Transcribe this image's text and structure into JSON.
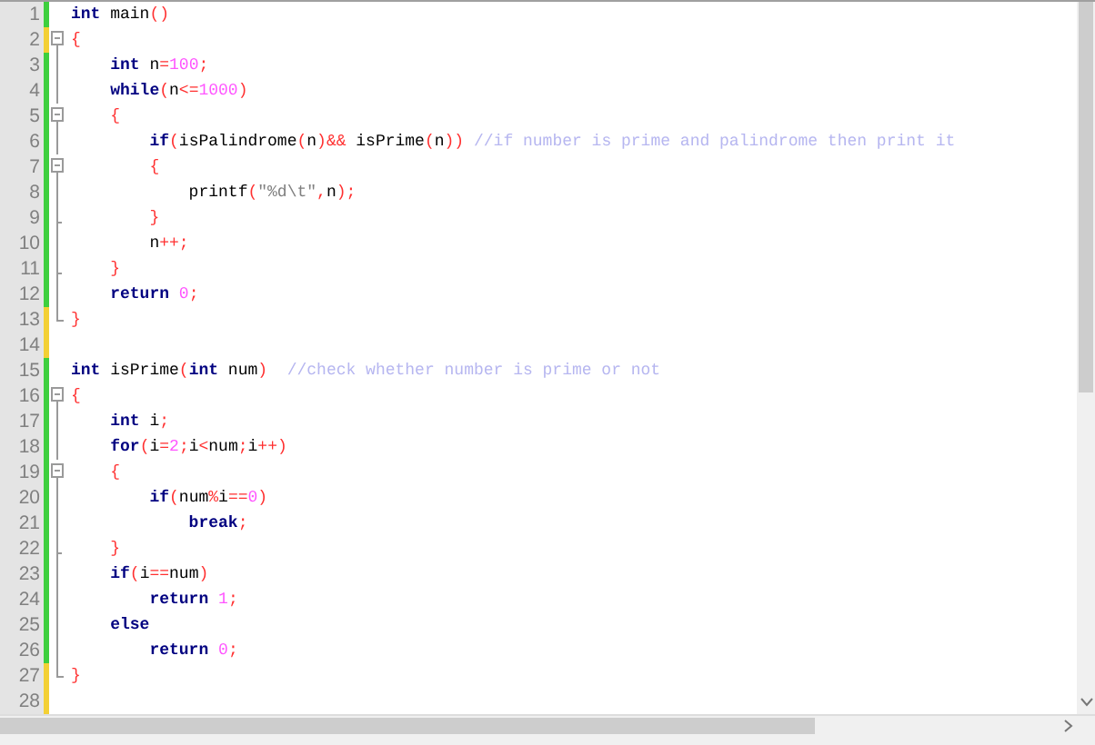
{
  "editor": {
    "lines": [
      {
        "number": "1",
        "saved": true,
        "kind": "plain",
        "tokens": [
          {
            "kind": "keyword",
            "text": "int"
          },
          {
            "kind": "plain",
            "text": " main"
          },
          {
            "kind": "op",
            "text": "()"
          }
        ]
      },
      {
        "number": "2",
        "saved": false,
        "kind": "start",
        "tokens": [
          {
            "kind": "op",
            "text": "{"
          }
        ]
      },
      {
        "number": "3",
        "saved": true,
        "kind": "body",
        "tokens": [
          {
            "kind": "keyword",
            "text": "    int"
          },
          {
            "kind": "plain",
            "text": " n"
          },
          {
            "kind": "op",
            "text": "="
          },
          {
            "kind": "number",
            "text": "100"
          },
          {
            "kind": "op",
            "text": ";"
          }
        ]
      },
      {
        "number": "4",
        "saved": true,
        "kind": "body",
        "tokens": [
          {
            "kind": "keyword",
            "text": "    while"
          },
          {
            "kind": "op",
            "text": "("
          },
          {
            "kind": "plain",
            "text": "n"
          },
          {
            "kind": "op",
            "text": "<="
          },
          {
            "kind": "number",
            "text": "1000"
          },
          {
            "kind": "op",
            "text": ")"
          }
        ]
      },
      {
        "number": "5",
        "saved": true,
        "kind": "start",
        "tokens": [
          {
            "kind": "op",
            "text": "    {"
          }
        ]
      },
      {
        "number": "6",
        "saved": true,
        "kind": "body",
        "tokens": [
          {
            "kind": "keyword",
            "text": "        if"
          },
          {
            "kind": "op",
            "text": "("
          },
          {
            "kind": "plain",
            "text": "isPalindrome"
          },
          {
            "kind": "op",
            "text": "("
          },
          {
            "kind": "plain",
            "text": "n"
          },
          {
            "kind": "op",
            "text": ")&&"
          },
          {
            "kind": "plain",
            "text": " isPrime"
          },
          {
            "kind": "op",
            "text": "("
          },
          {
            "kind": "plain",
            "text": "n"
          },
          {
            "kind": "op",
            "text": "))"
          },
          {
            "kind": "comment",
            "text": " //if number is prime and palindrome then print it"
          }
        ]
      },
      {
        "number": "7",
        "saved": true,
        "kind": "start",
        "tokens": [
          {
            "kind": "op",
            "text": "        {"
          }
        ]
      },
      {
        "number": "8",
        "saved": true,
        "kind": "body",
        "tokens": [
          {
            "kind": "plain",
            "text": "            printf"
          },
          {
            "kind": "op",
            "text": "("
          },
          {
            "kind": "string",
            "text": "\"%d\\t\""
          },
          {
            "kind": "op",
            "text": ","
          },
          {
            "kind": "plain",
            "text": "n"
          },
          {
            "kind": "op",
            "text": ");"
          }
        ]
      },
      {
        "number": "9",
        "saved": true,
        "kind": "stop",
        "tokens": [
          {
            "kind": "op",
            "text": "        }"
          }
        ]
      },
      {
        "number": "10",
        "saved": true,
        "kind": "body",
        "tokens": [
          {
            "kind": "plain",
            "text": "        n"
          },
          {
            "kind": "op",
            "text": "++;"
          }
        ]
      },
      {
        "number": "11",
        "saved": true,
        "kind": "stop",
        "tokens": [
          {
            "kind": "op",
            "text": "    }"
          }
        ]
      },
      {
        "number": "12",
        "saved": true,
        "kind": "body",
        "tokens": [
          {
            "kind": "keyword",
            "text": "    return"
          },
          {
            "kind": "number",
            "text": " 0"
          },
          {
            "kind": "op",
            "text": ";"
          }
        ]
      },
      {
        "number": "13",
        "saved": false,
        "kind": "end",
        "tokens": [
          {
            "kind": "op",
            "text": "}"
          }
        ]
      },
      {
        "number": "14",
        "saved": false,
        "kind": "plain"
      },
      {
        "number": "15",
        "saved": true,
        "kind": "plain",
        "tokens": [
          {
            "kind": "keyword",
            "text": "int"
          },
          {
            "kind": "plain",
            "text": " isPrime"
          },
          {
            "kind": "op",
            "text": "("
          },
          {
            "kind": "keyword",
            "text": "int"
          },
          {
            "kind": "plain",
            "text": " num"
          },
          {
            "kind": "op",
            "text": ")"
          },
          {
            "kind": "comment",
            "text": "  //check whether number is prime or not"
          }
        ]
      },
      {
        "number": "16",
        "saved": true,
        "kind": "start",
        "tokens": [
          {
            "kind": "op",
            "text": "{"
          }
        ]
      },
      {
        "number": "17",
        "saved": true,
        "kind": "body",
        "tokens": [
          {
            "kind": "keyword",
            "text": "    int"
          },
          {
            "kind": "plain",
            "text": " i"
          },
          {
            "kind": "op",
            "text": ";"
          }
        ]
      },
      {
        "number": "18",
        "saved": true,
        "kind": "body",
        "tokens": [
          {
            "kind": "keyword",
            "text": "    for"
          },
          {
            "kind": "op",
            "text": "("
          },
          {
            "kind": "plain",
            "text": "i"
          },
          {
            "kind": "op",
            "text": "="
          },
          {
            "kind": "number",
            "text": "2"
          },
          {
            "kind": "op",
            "text": ";"
          },
          {
            "kind": "plain",
            "text": "i"
          },
          {
            "kind": "op",
            "text": "<"
          },
          {
            "kind": "plain",
            "text": "num"
          },
          {
            "kind": "op",
            "text": ";"
          },
          {
            "kind": "plain",
            "text": "i"
          },
          {
            "kind": "op",
            "text": "++)"
          }
        ]
      },
      {
        "number": "19",
        "saved": true,
        "kind": "start",
        "tokens": [
          {
            "kind": "op",
            "text": "    {"
          }
        ]
      },
      {
        "number": "20",
        "saved": true,
        "kind": "body",
        "tokens": [
          {
            "kind": "keyword",
            "text": "        if"
          },
          {
            "kind": "op",
            "text": "("
          },
          {
            "kind": "plain",
            "text": "num"
          },
          {
            "kind": "op",
            "text": "%"
          },
          {
            "kind": "plain",
            "text": "i"
          },
          {
            "kind": "op",
            "text": "=="
          },
          {
            "kind": "number",
            "text": "0"
          },
          {
            "kind": "op",
            "text": ")"
          }
        ]
      },
      {
        "number": "21",
        "saved": true,
        "kind": "body",
        "tokens": [
          {
            "kind": "keyword",
            "text": "            break"
          },
          {
            "kind": "op",
            "text": ";"
          }
        ]
      },
      {
        "number": "22",
        "saved": true,
        "kind": "stop",
        "tokens": [
          {
            "kind": "op",
            "text": "    }"
          }
        ]
      },
      {
        "number": "23",
        "saved": true,
        "kind": "body",
        "tokens": [
          {
            "kind": "keyword",
            "text": "    if"
          },
          {
            "kind": "op",
            "text": "("
          },
          {
            "kind": "plain",
            "text": "i"
          },
          {
            "kind": "op",
            "text": "=="
          },
          {
            "kind": "plain",
            "text": "num"
          },
          {
            "kind": "op",
            "text": ")"
          }
        ]
      },
      {
        "number": "24",
        "saved": true,
        "kind": "body",
        "tokens": [
          {
            "kind": "keyword",
            "text": "        return"
          },
          {
            "kind": "number",
            "text": " 1"
          },
          {
            "kind": "op",
            "text": ";"
          }
        ]
      },
      {
        "number": "25",
        "saved": true,
        "kind": "body",
        "tokens": [
          {
            "kind": "keyword",
            "text": "    else"
          }
        ]
      },
      {
        "number": "26",
        "saved": true,
        "kind": "body",
        "tokens": [
          {
            "kind": "keyword",
            "text": "        return"
          },
          {
            "kind": "number",
            "text": " 0"
          },
          {
            "kind": "op",
            "text": ";"
          }
        ]
      },
      {
        "number": "27",
        "saved": false,
        "kind": "end",
        "tokens": [
          {
            "kind": "op",
            "text": "}"
          }
        ]
      },
      {
        "number": "28",
        "saved": false,
        "kind": "plain"
      }
    ]
  }
}
